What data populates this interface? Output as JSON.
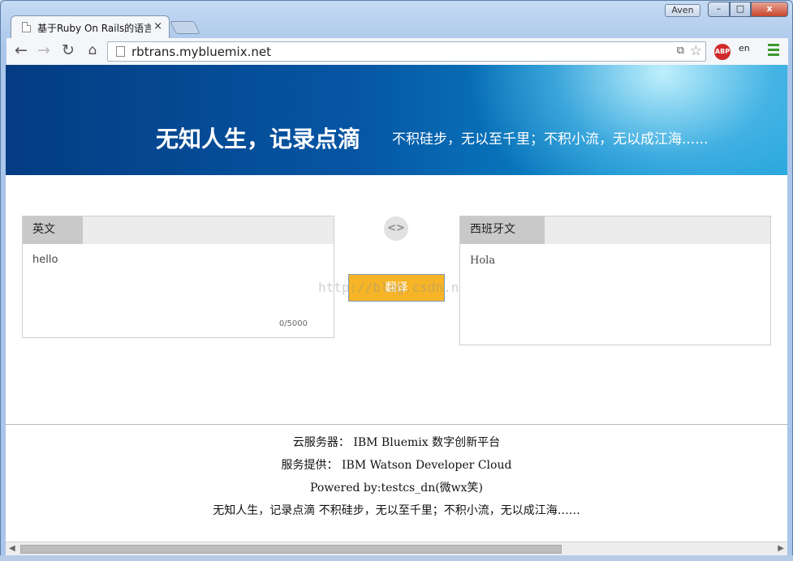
{
  "window": {
    "tab_title": "基于Ruby On Rails的语言",
    "tab_close": "×",
    "profile_name": "Aven",
    "min_label": "–",
    "max_label": "□",
    "close_label": "x"
  },
  "toolbar": {
    "back": "←",
    "forward": "→",
    "reload": "↻",
    "home": "⌂",
    "url": "rbtrans.mybluemix.net",
    "star": "☆",
    "translate_icon": "⧉",
    "abp_label": "ABP",
    "ext_trans_label": "en"
  },
  "banner": {
    "brand": "无知人生，记录点滴",
    "slogan": "不积硅步，无以至千里；不积小流，无以成江海......"
  },
  "source": {
    "language": "英文",
    "text": "hello",
    "counter": "0/5000"
  },
  "target": {
    "language": "西班牙文",
    "text": "Hola"
  },
  "swap_label": "<>",
  "translate_button": "翻译",
  "watermark": "http://blog.csdn.net/",
  "footer": {
    "line1": "云服务器： IBM Bluemix 数字创新平台",
    "line2": "服务提供： IBM Watson Developer Cloud",
    "line3": "Powered by:testcs_dn(微wx笑)",
    "line4": "无知人生，记录点滴 不积硅步，无以至千里；不积小流，无以成江海……"
  },
  "scroll": {
    "left_arrow": "◀",
    "right_arrow": "▶"
  },
  "colors": {
    "banner_dark": "#043c82",
    "banner_light": "#27a7dc",
    "button": "#f6b426",
    "abp": "#d02a2a",
    "menu": "#3a9a2d"
  }
}
